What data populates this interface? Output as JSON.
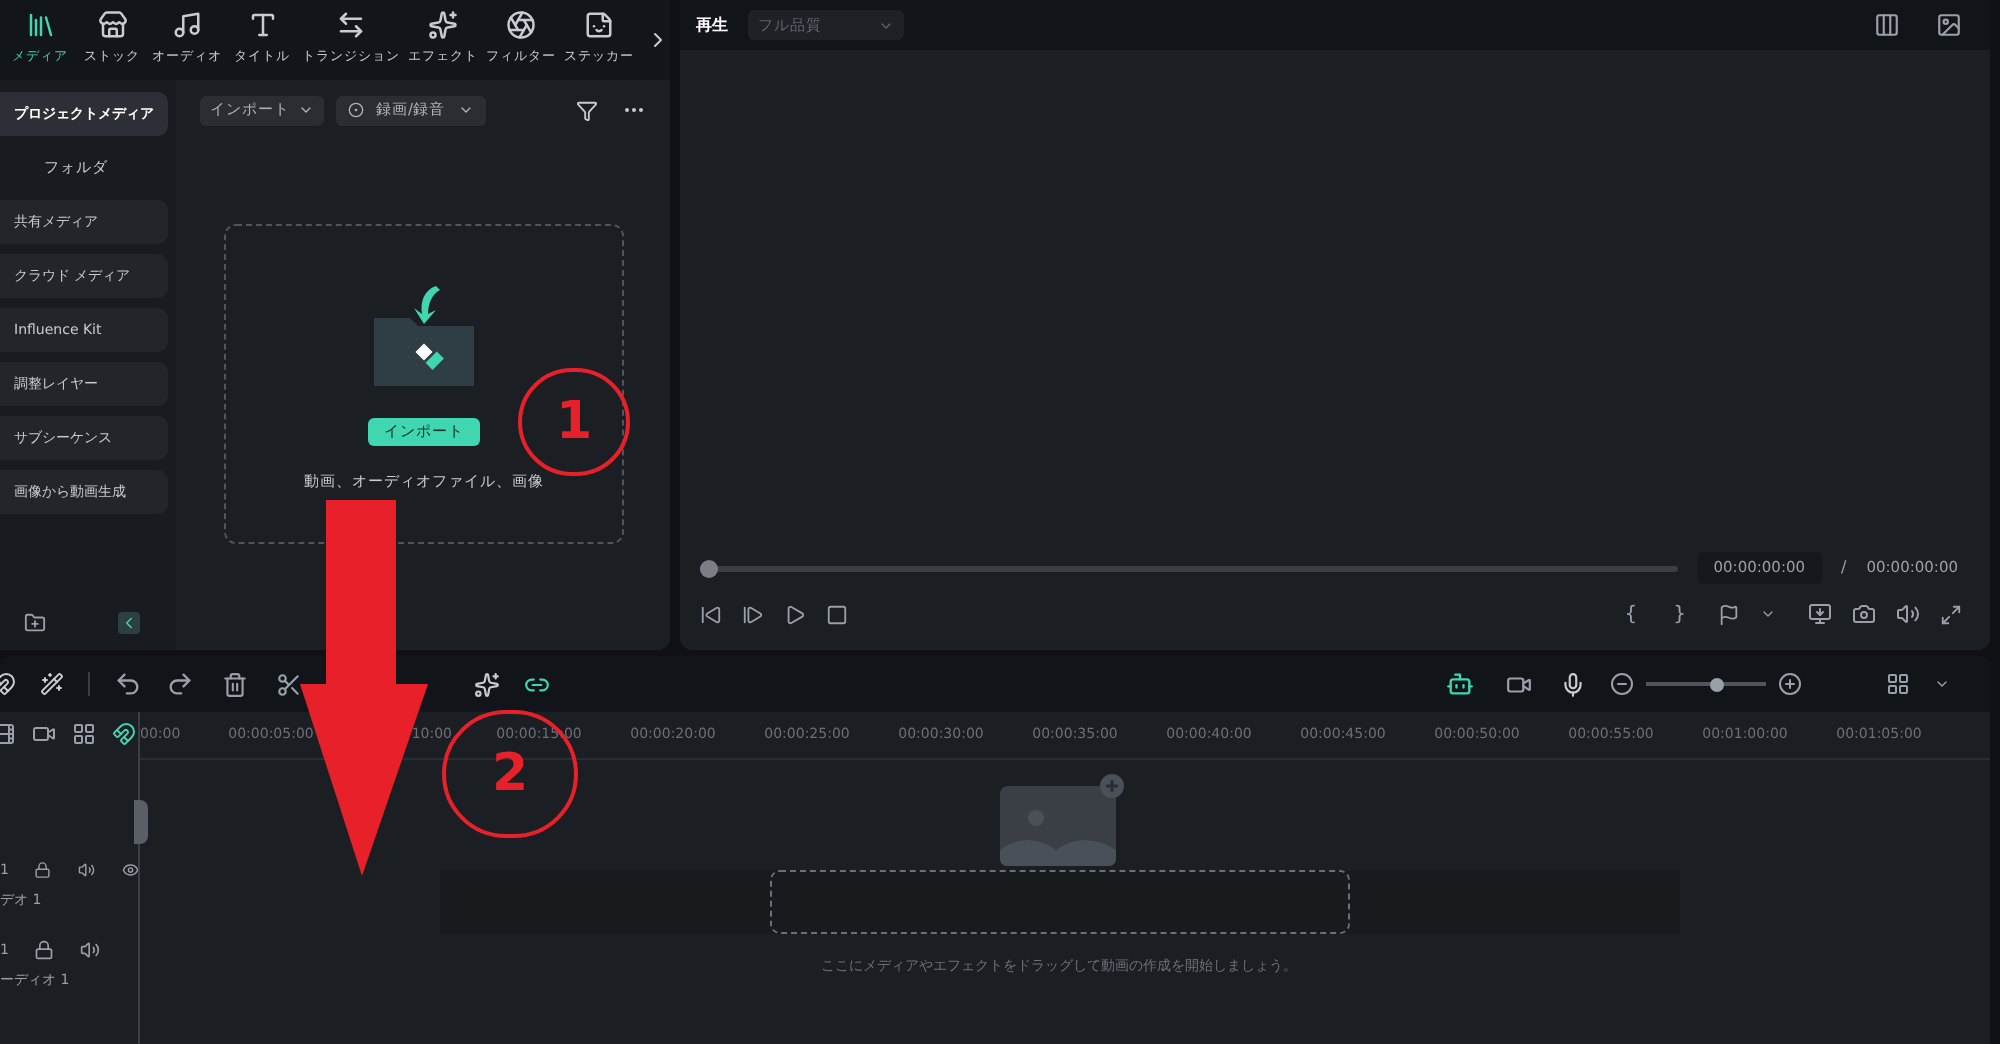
{
  "media_tabs": [
    {
      "label": "メディア",
      "selected": true
    },
    {
      "label": "ストック",
      "selected": false
    },
    {
      "label": "オーディオ",
      "selected": false
    },
    {
      "label": "タイトル",
      "selected": false
    },
    {
      "label": "トランジション",
      "selected": false
    },
    {
      "label": "エフェクト",
      "selected": false
    },
    {
      "label": "フィルター",
      "selected": false
    },
    {
      "label": "ステッカー",
      "selected": false
    }
  ],
  "media_toolbar": {
    "import_dropdown": "インポート",
    "record_dropdown": "録画/録音"
  },
  "sidebar": {
    "items": [
      {
        "label": "プロジェクトメディア",
        "selected": true,
        "children": [
          {
            "label": "フォルダ",
            "selected": false
          }
        ]
      },
      {
        "label": "共有メディア",
        "selected": false
      },
      {
        "label": "クラウド メディア",
        "selected": false
      },
      {
        "label": "Influence Kit",
        "selected": false
      },
      {
        "label": "調整レイヤー",
        "selected": false
      },
      {
        "label": "サブシーケンス",
        "selected": false
      },
      {
        "label": "画像から動画生成",
        "selected": false
      }
    ]
  },
  "import_area": {
    "button": "インポート",
    "hint": "動画、オーディオファイル、画像"
  },
  "player": {
    "title": "再生",
    "quality": "フル品質",
    "progress": {
      "level": 0
    },
    "current_time": "00:00:00:00",
    "separator": "/",
    "total_time": "00:00:00:00",
    "mark_in": "{",
    "mark_out": "}"
  },
  "timeline": {
    "ruler": [
      "00:00",
      "00:00:05:00",
      "10:00",
      "00:00:15:00",
      "00:00:20:00",
      "00:00:25:00",
      "00:00:30:00",
      "00:00:35:00",
      "00:00:40:00",
      "00:00:45:00",
      "00:00:50:00",
      "00:00:55:00",
      "00:01:00:00",
      "00:01:05:00"
    ],
    "tracks": [
      {
        "kind": "video",
        "number": "1",
        "name": "デオ 1"
      },
      {
        "kind": "audio",
        "number": "1",
        "name": "ーディオ 1"
      }
    ],
    "drop_hint": "ここにメディアやエフェクトをドラッグして動画の作成を開始しましょう。",
    "zoom": {
      "level": 0.6
    }
  },
  "annotations": [
    {
      "kind": "circle",
      "text": "1"
    },
    {
      "kind": "circle",
      "text": "2"
    },
    {
      "kind": "arrow"
    }
  ]
}
